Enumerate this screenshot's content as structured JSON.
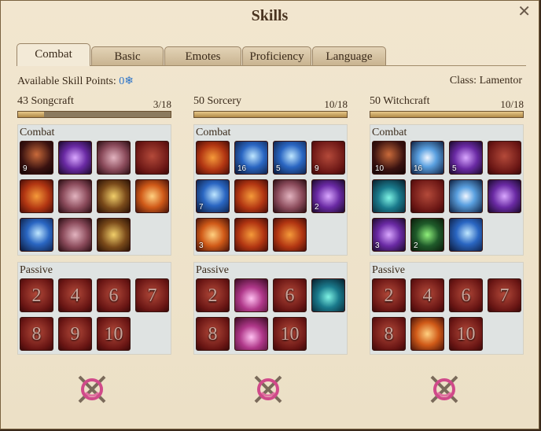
{
  "window": {
    "title": "Skills",
    "close_glyph": "✕"
  },
  "tabs": [
    {
      "label": "Combat",
      "active": true
    },
    {
      "label": "Basic"
    },
    {
      "label": "Emotes"
    },
    {
      "label": "Proficiency"
    },
    {
      "label": "Language"
    }
  ],
  "header": {
    "skill_points_label": "Available Skill Points:",
    "skill_points_value": "0",
    "class_label": "Class: Lamentor"
  },
  "columns": [
    {
      "name": "43 Songcraft",
      "level": "3/18",
      "progress": 0.17,
      "combat_label": "Combat",
      "combat": [
        {
          "color": "c-dark",
          "num": "9",
          "icon": "lyre-icon"
        },
        {
          "color": "c-purple",
          "num": "",
          "icon": "music-notes-icon"
        },
        {
          "color": "c-mauve",
          "num": "",
          "icon": "treble-clef-icon"
        },
        {
          "color": "c-red",
          "num": "",
          "icon": "roar-icon"
        },
        {
          "color": "c-fire",
          "num": "",
          "icon": "note-burst-icon"
        },
        {
          "color": "c-mauve",
          "num": "",
          "icon": "sheet-music-icon"
        },
        {
          "color": "c-gold",
          "num": "",
          "icon": "healing-hymn-icon"
        },
        {
          "color": "c-orange",
          "num": "",
          "icon": "resonance-icon"
        },
        {
          "color": "c-blue",
          "num": "",
          "icon": "lute-strike-icon"
        },
        {
          "color": "c-mauve",
          "num": "",
          "icon": "song-scroll-icon"
        },
        {
          "color": "c-gold",
          "num": "",
          "icon": "war-horn-icon"
        }
      ],
      "passive_label": "Passive",
      "passive": [
        {
          "color": "c-red",
          "label": "2"
        },
        {
          "color": "c-red",
          "label": "4"
        },
        {
          "color": "c-red",
          "label": "6"
        },
        {
          "color": "c-red",
          "label": "7"
        },
        {
          "color": "c-red",
          "label": "8"
        },
        {
          "color": "c-red",
          "label": "9"
        },
        {
          "color": "c-red",
          "label": "10"
        }
      ]
    },
    {
      "name": "50 Sorcery",
      "level": "10/18",
      "progress": 1.0,
      "combat_label": "Combat",
      "combat": [
        {
          "color": "c-fire",
          "num": "",
          "icon": "fireball-icon"
        },
        {
          "color": "c-blue",
          "num": "16",
          "icon": "frost-bolt-icon"
        },
        {
          "color": "c-blue",
          "num": "5",
          "icon": "lightning-icon"
        },
        {
          "color": "c-red",
          "num": "9",
          "icon": "chain-lightning-icon"
        },
        {
          "color": "c-blue",
          "num": "7",
          "icon": "ice-wave-icon"
        },
        {
          "color": "c-fire",
          "num": "",
          "icon": "flame-pillar-icon"
        },
        {
          "color": "c-mauve",
          "num": "",
          "icon": "footprints-icon"
        },
        {
          "color": "c-purple",
          "num": "2",
          "icon": "magic-scroll-icon"
        },
        {
          "color": "c-orange",
          "num": "3",
          "icon": "thunderbolt-icon"
        },
        {
          "color": "c-fire",
          "num": "",
          "icon": "firewall-icon"
        },
        {
          "color": "c-fire",
          "num": "",
          "icon": "meteor-icon"
        }
      ],
      "passive_label": "Passive",
      "passive": [
        {
          "color": "c-red",
          "label": "2"
        },
        {
          "color": "c-pink",
          "label": "",
          "icon": "arcane-swirl-icon"
        },
        {
          "color": "c-red",
          "label": "6"
        },
        {
          "color": "c-teal",
          "label": "",
          "icon": "vortex-icon"
        },
        {
          "color": "c-red",
          "label": "8"
        },
        {
          "color": "c-pink",
          "label": "",
          "icon": "mana-surge-icon"
        },
        {
          "color": "c-red",
          "label": "10"
        }
      ]
    },
    {
      "name": "50 Witchcraft",
      "level": "10/18",
      "progress": 1.0,
      "combat_label": "Combat",
      "combat": [
        {
          "color": "c-dark",
          "num": "10",
          "icon": "cursed-hand-icon"
        },
        {
          "color": "c-sky",
          "num": "16",
          "icon": "dark-grasp-icon"
        },
        {
          "color": "c-purple",
          "num": "5",
          "icon": "eclipse-icon"
        },
        {
          "color": "c-red",
          "num": "",
          "icon": "demon-face-icon"
        },
        {
          "color": "c-teal",
          "num": "",
          "icon": "silhouette-icon"
        },
        {
          "color": "c-red",
          "num": "",
          "icon": "blood-curse-icon"
        },
        {
          "color": "c-sky",
          "num": "",
          "icon": "banish-icon"
        },
        {
          "color": "c-purple",
          "num": "",
          "icon": "halo-icon"
        },
        {
          "color": "c-purple",
          "num": "3",
          "icon": "fiend-icon"
        },
        {
          "color": "c-green",
          "num": "2",
          "icon": "spirit-icon"
        },
        {
          "color": "c-blue",
          "num": "",
          "icon": "tidal-wave-icon"
        }
      ],
      "passive_label": "Passive",
      "passive": [
        {
          "color": "c-red",
          "label": "2"
        },
        {
          "color": "c-red",
          "label": "4"
        },
        {
          "color": "c-red",
          "label": "6"
        },
        {
          "color": "c-red",
          "label": "7"
        },
        {
          "color": "c-red",
          "label": "8"
        },
        {
          "color": "c-orange",
          "label": "",
          "icon": "sun-burst-icon"
        },
        {
          "color": "c-red",
          "label": "10"
        }
      ]
    }
  ]
}
